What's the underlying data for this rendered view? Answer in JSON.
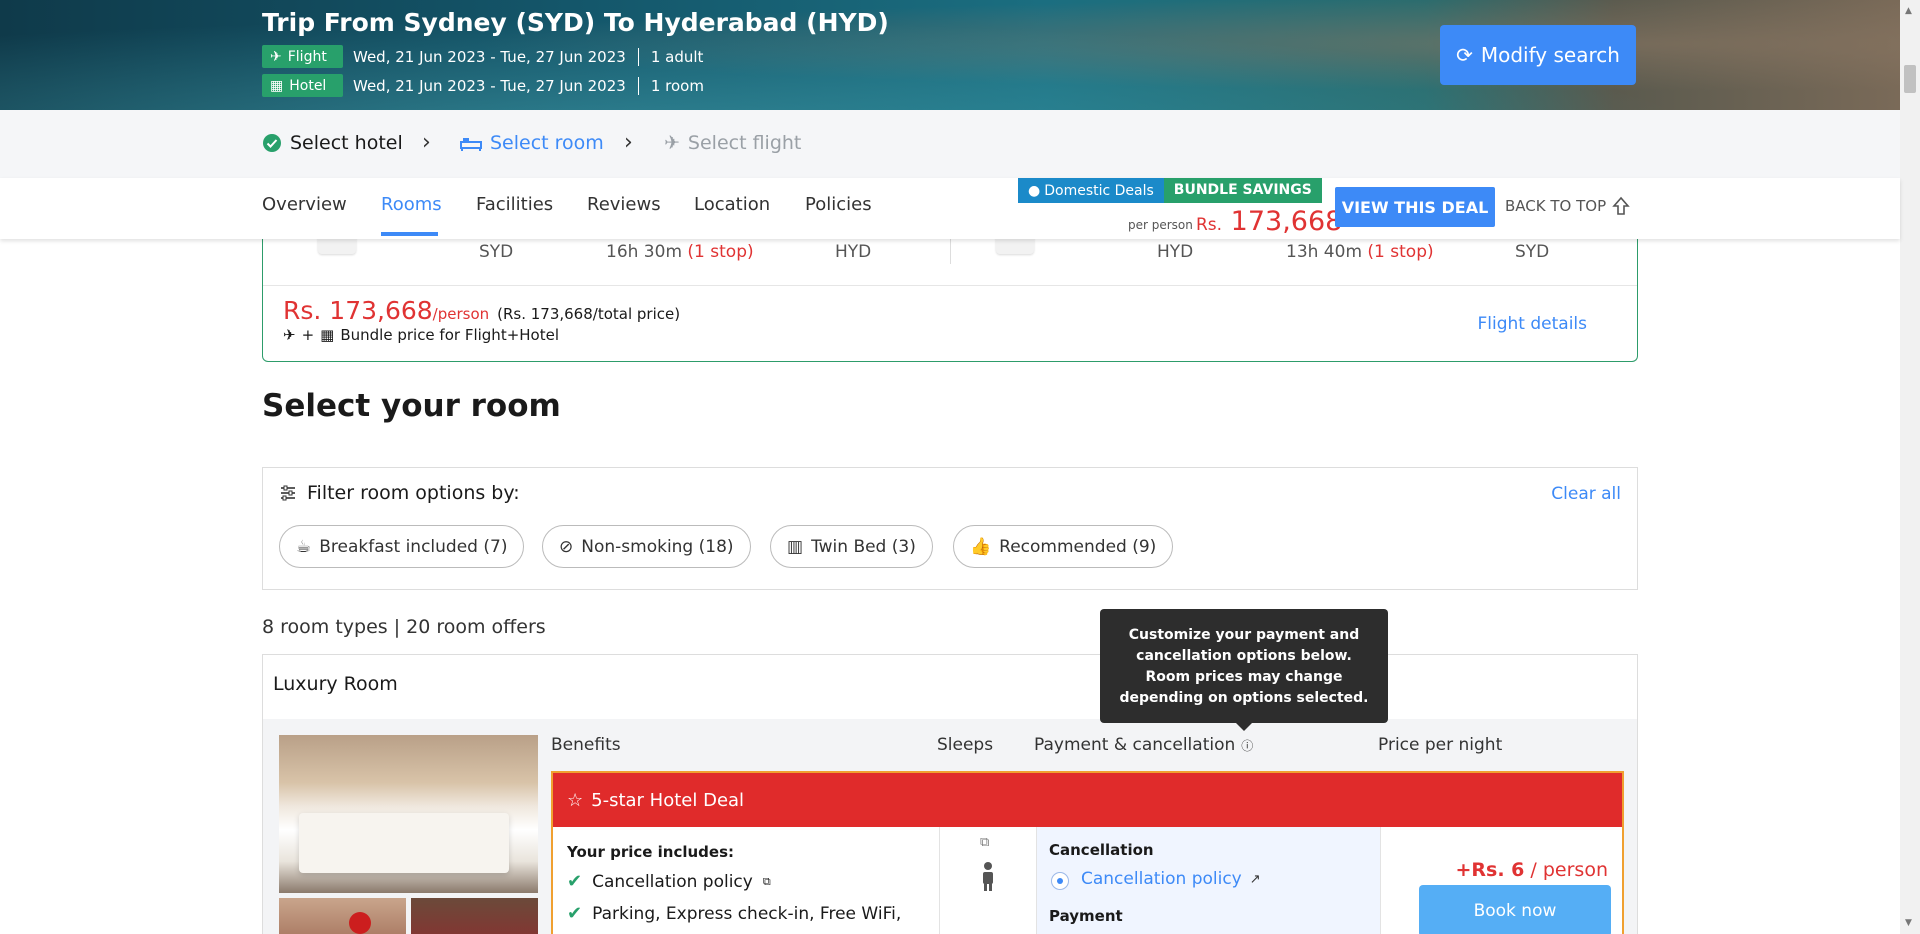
{
  "hero": {
    "title": "Trip From Sydney (SYD) To Hyderabad (HYD)",
    "flight_badge": "Flight",
    "flight_dates": "Wed, 21 Jun 2023 - Tue, 27 Jun 2023",
    "flight_pax": "1 adult",
    "hotel_badge": "Hotel",
    "hotel_dates": "Wed, 21 Jun 2023 - Tue, 27 Jun 2023",
    "hotel_rooms": "1 room",
    "modify_label": "Modify search"
  },
  "steps": {
    "select_hotel": "Select hotel",
    "select_room": "Select room",
    "select_flight": "Select flight"
  },
  "tabs": [
    "Overview",
    "Rooms",
    "Facilities",
    "Reviews",
    "Location",
    "Policies"
  ],
  "deal": {
    "domestic": "Domestic Deals",
    "bundle": "BUNDLE SAVINGS",
    "per_person": "per person",
    "currency": "Rs.",
    "price": "173,668",
    "view_label": "VIEW THIS DEAL",
    "back_to_top": "BACK TO TOP"
  },
  "flight_card": {
    "out_from": "SYD",
    "out_duration": "16h 30m",
    "out_stops": "(1 stop)",
    "out_to": "HYD",
    "ret_from": "HYD",
    "ret_duration": "13h 40m",
    "ret_stops": "(1 stop)",
    "ret_to": "SYD",
    "price": "Rs. 173,668",
    "per_person": "/person",
    "total": "(Rs. 173,668/total price)",
    "bundle_text": "Bundle price for Flight+Hotel",
    "details_link": "Flight details"
  },
  "rooms_section": {
    "title": "Select your room",
    "filter_heading": "Filter room options by:",
    "clear_all": "Clear all",
    "chips": [
      "Breakfast included (7)",
      "Non-smoking (18)",
      "Twin Bed (3)",
      "Recommended (9)"
    ],
    "counts": "8 room types | 20 room offers"
  },
  "tooltip": "Customize your payment and cancellation options below. Room prices may change depending on options selected.",
  "room": {
    "name": "Luxury Room",
    "col_benefits": "Benefits",
    "col_sleeps": "Sleeps",
    "col_payment": "Payment & cancellation",
    "col_price": "Price per night",
    "deal_label": "5-star Hotel Deal",
    "price_includes": "Your price includes:",
    "benefits": [
      "Cancellation policy",
      "Parking, Express check-in, Free WiFi,"
    ],
    "cancellation_label": "Cancellation",
    "cancellation_option": "Cancellation policy",
    "payment_label": "Payment",
    "price_prefix": "+Rs. 6",
    "price_suffix": " / person",
    "book_label": "Book now"
  },
  "colors": {
    "accent_blue": "#3d8af7",
    "green": "#28a06b",
    "red": "#e03333",
    "deal_red": "#e02b2b"
  }
}
